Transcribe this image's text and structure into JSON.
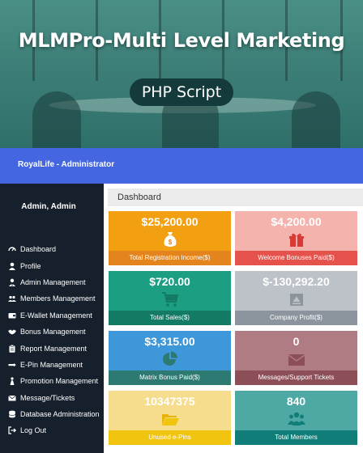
{
  "hero": {
    "title": "MLMPro-Multi Level Marketing",
    "badge": "PHP Script"
  },
  "topbar": {
    "brand": "RoyalLife - Administrator"
  },
  "sidebar": {
    "user": "Admin, Admin",
    "items": [
      {
        "label": "Dashboard",
        "icon": "speedometer-icon"
      },
      {
        "label": "Profile",
        "icon": "user-icon"
      },
      {
        "label": "Admin Management",
        "icon": "user-tie-icon"
      },
      {
        "label": "Members Management",
        "icon": "users-icon"
      },
      {
        "label": "E-Wallet Management",
        "icon": "wallet-icon"
      },
      {
        "label": "Bonus Management",
        "icon": "handshake-icon"
      },
      {
        "label": "Report Management",
        "icon": "clipboard-icon"
      },
      {
        "label": "E-Pin Management",
        "icon": "pin-icon"
      },
      {
        "label": "Promotion Management",
        "icon": "person-icon"
      },
      {
        "label": "Message/Tickets",
        "icon": "envelope-icon"
      },
      {
        "label": "Database Administration",
        "icon": "database-icon"
      },
      {
        "label": "Log Out",
        "icon": "logout-icon"
      }
    ]
  },
  "content": {
    "breadcrumb": "Dashboard",
    "cards": [
      {
        "value": "$25,200.00",
        "label": "Total Registration Income($)",
        "icon": "money-bag-icon",
        "top_color": "#f2a012",
        "foot_color": "#e3841d"
      },
      {
        "value": "$4,200.00",
        "label": "Welcome Bonuses Paid($)",
        "icon": "gift-icon",
        "top_color": "#f5b3ae",
        "foot_color": "#e4524b"
      },
      {
        "value": "$720.00",
        "label": "Total Sales($)",
        "icon": "cart-icon",
        "top_color": "#1b9e82",
        "foot_color": "#137a64"
      },
      {
        "value": "$-130,292.20",
        "label": "Company Profit($)",
        "icon": "bank-icon",
        "top_color": "#bcc2c8",
        "foot_color": "#8c959e"
      },
      {
        "value": "$3,315.00",
        "label": "Matrix Bonus Paid($)",
        "icon": "pie-chart-icon",
        "top_color": "#3d97d9",
        "foot_color": "#2c7a72"
      },
      {
        "value": "0",
        "label": "Messages/Support Tickets",
        "icon": "envelope-icon",
        "top_color": "#b07c83",
        "foot_color": "#8c4e57"
      },
      {
        "value": "10347375",
        "label": "Unused e-Pins",
        "icon": "folder-open-icon",
        "top_color": "#f6dd8e",
        "foot_color": "#f1c40f"
      },
      {
        "value": "840",
        "label": "Total Members",
        "icon": "users-icon",
        "top_color": "#4ea9a5",
        "foot_color": "#117d78"
      }
    ]
  }
}
